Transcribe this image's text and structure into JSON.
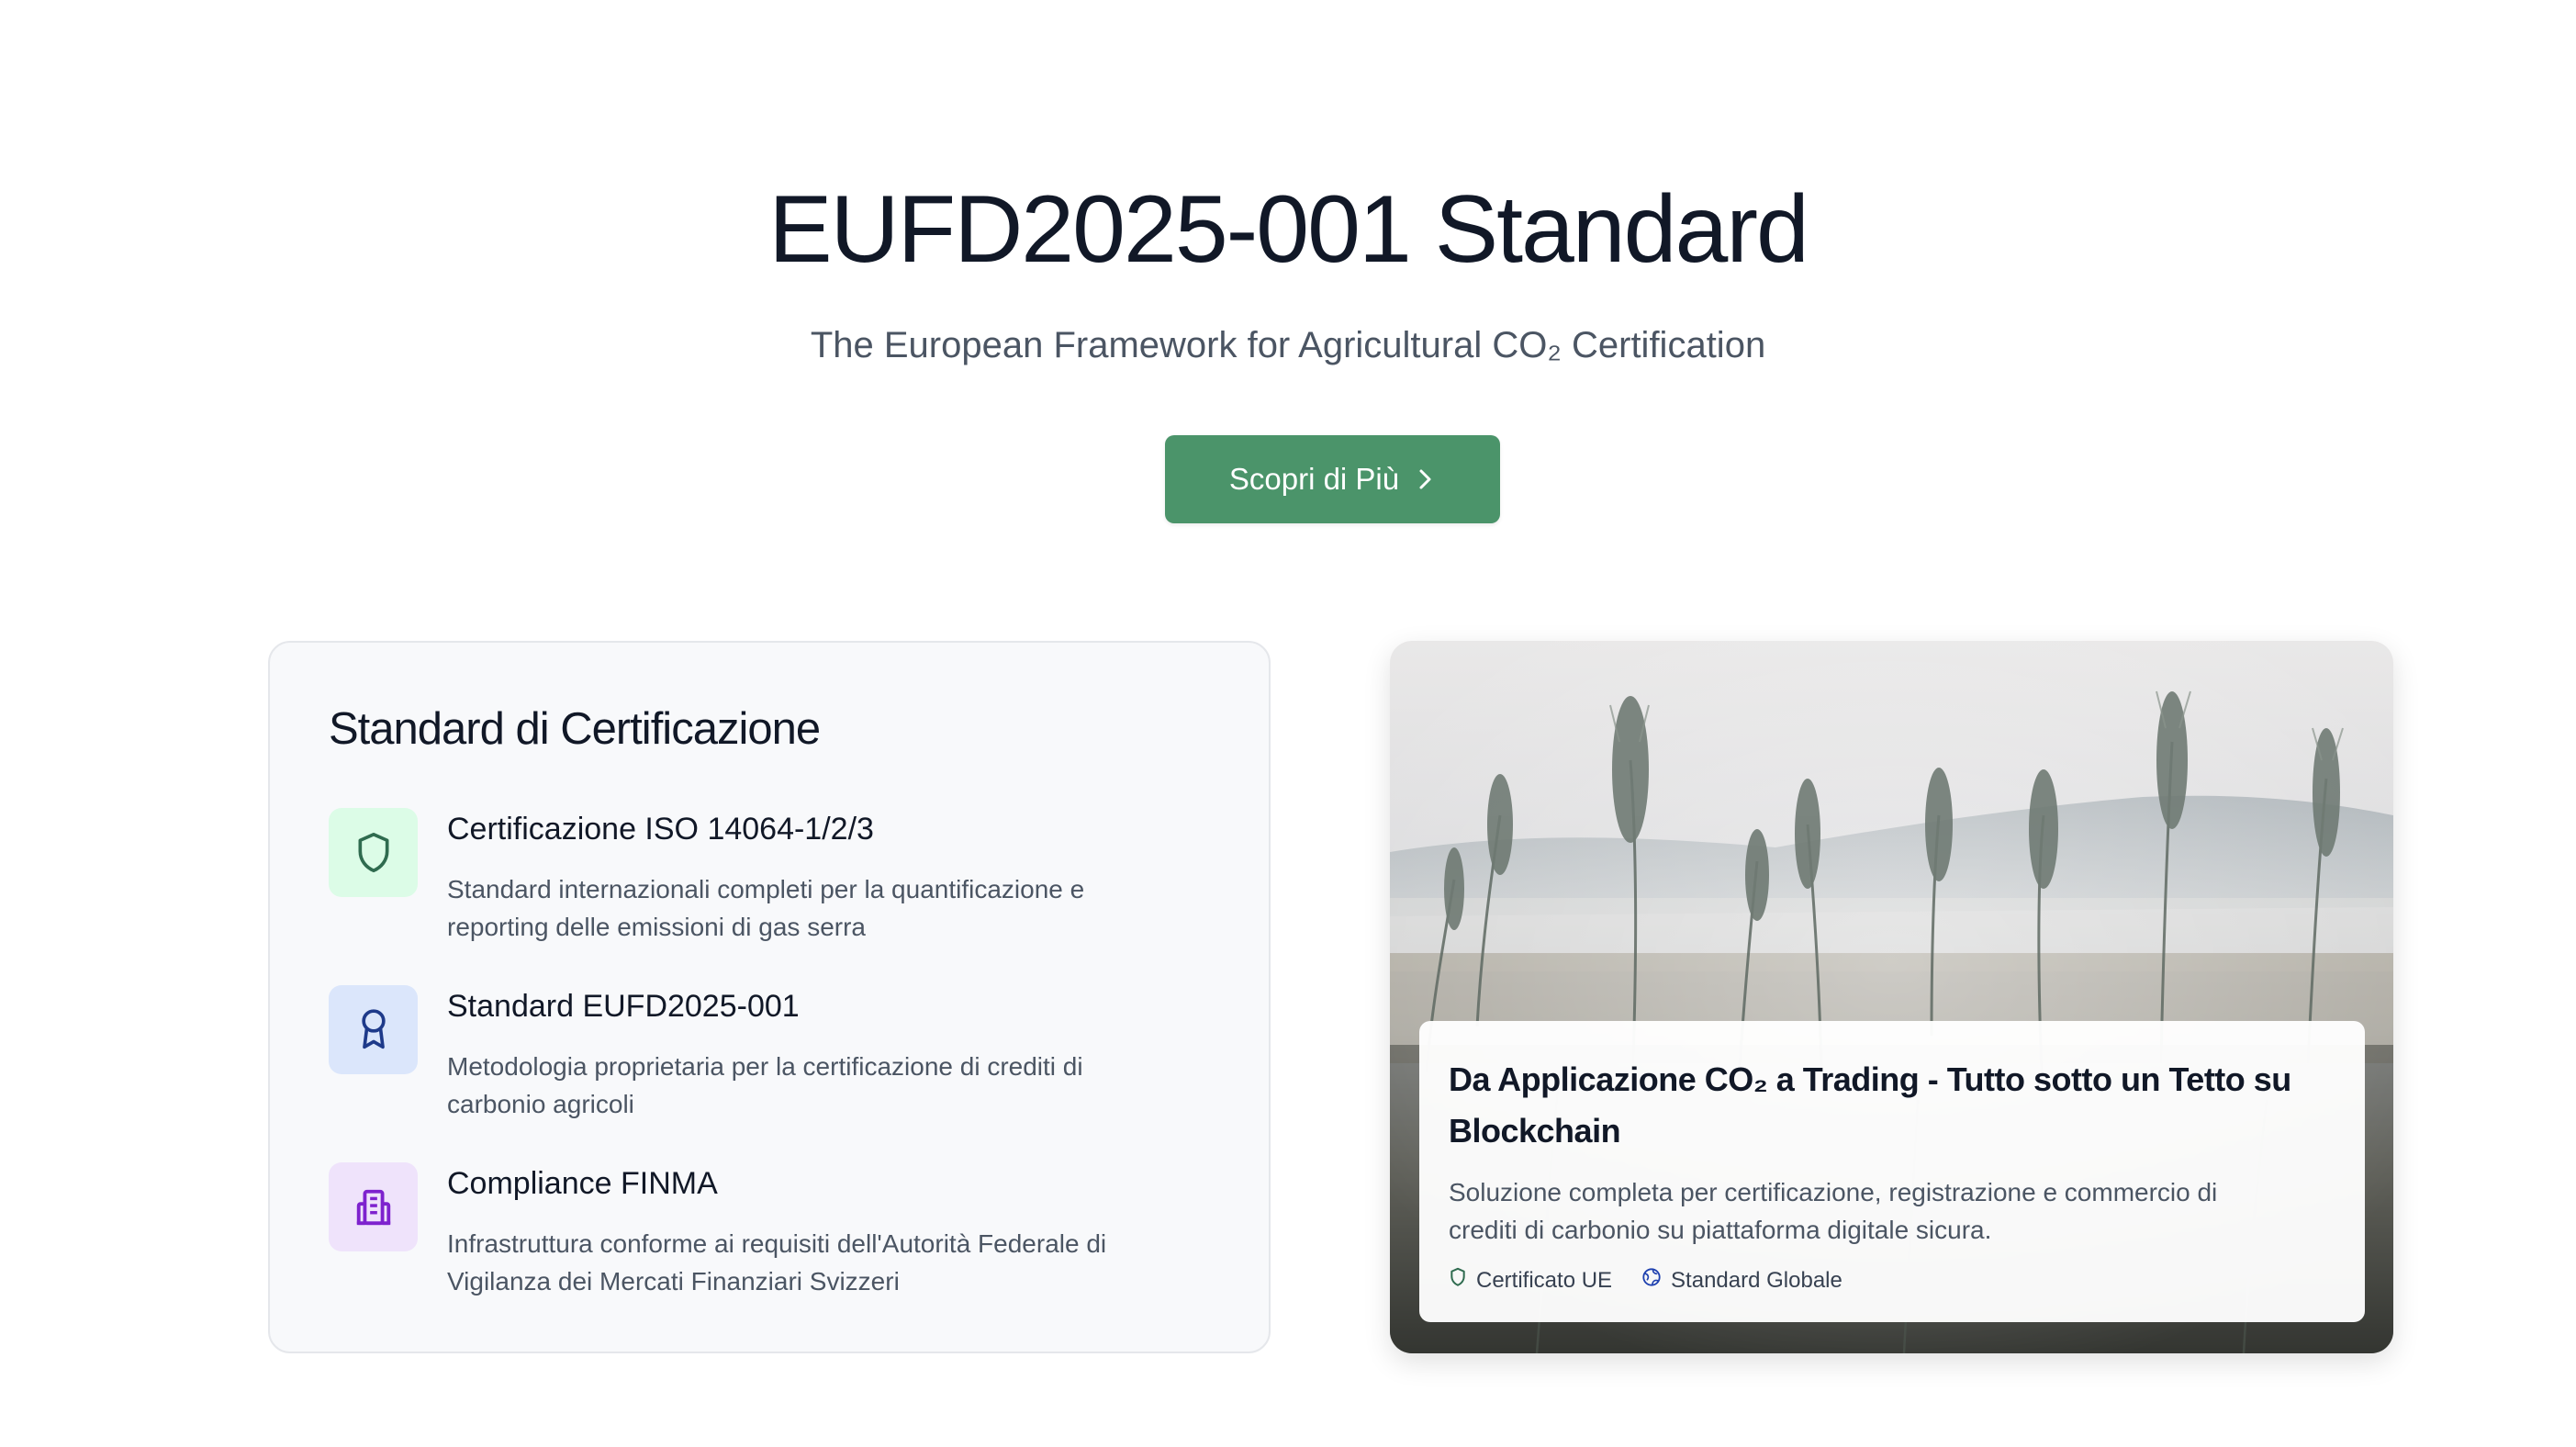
{
  "hero": {
    "title": "EUFD2025-001 Standard",
    "subtitle": "The European Framework for Agricultural CO₂ Certification",
    "cta_label": "Scopri di Più"
  },
  "certification_card": {
    "heading": "Standard di Certificazione",
    "features": [
      {
        "icon": "shield-icon",
        "title": "Certificazione ISO 14064-1/2/3",
        "description": "Standard internazionali completi per la quantificazione e reporting delle emissioni di gas serra"
      },
      {
        "icon": "award-icon",
        "title": "Standard EUFD2025-001",
        "description": "Metodologia proprietaria per la certificazione di crediti di carbonio agricoli"
      },
      {
        "icon": "building-icon",
        "title": "Compliance FINMA",
        "description": "Infrastruttura conforme ai requisiti dell'Autorità Federale di Vigilanza dei Mercati Finanziari Svizzeri"
      }
    ]
  },
  "image_card": {
    "image": "wheat-field-photo",
    "title": "Da Applicazione CO₂ a Trading - Tutto sotto un Tetto su Blockchain",
    "description": "Soluzione completa per certificazione, registrazione e commercio di crediti di carbonio su piattaforma digitale sicura.",
    "badges": [
      {
        "icon": "shield-icon",
        "label": "Certificato UE"
      },
      {
        "icon": "globe-icon",
        "label": "Standard Globale"
      }
    ]
  },
  "colors": {
    "primary_green": "#4b946a",
    "shield_bg": "#dcfce7",
    "shield_fg": "#2f6b4f",
    "award_bg": "#dbe6fb",
    "award_fg": "#1e3a8a",
    "building_bg": "#efe3fb",
    "building_fg": "#7e22ce"
  }
}
